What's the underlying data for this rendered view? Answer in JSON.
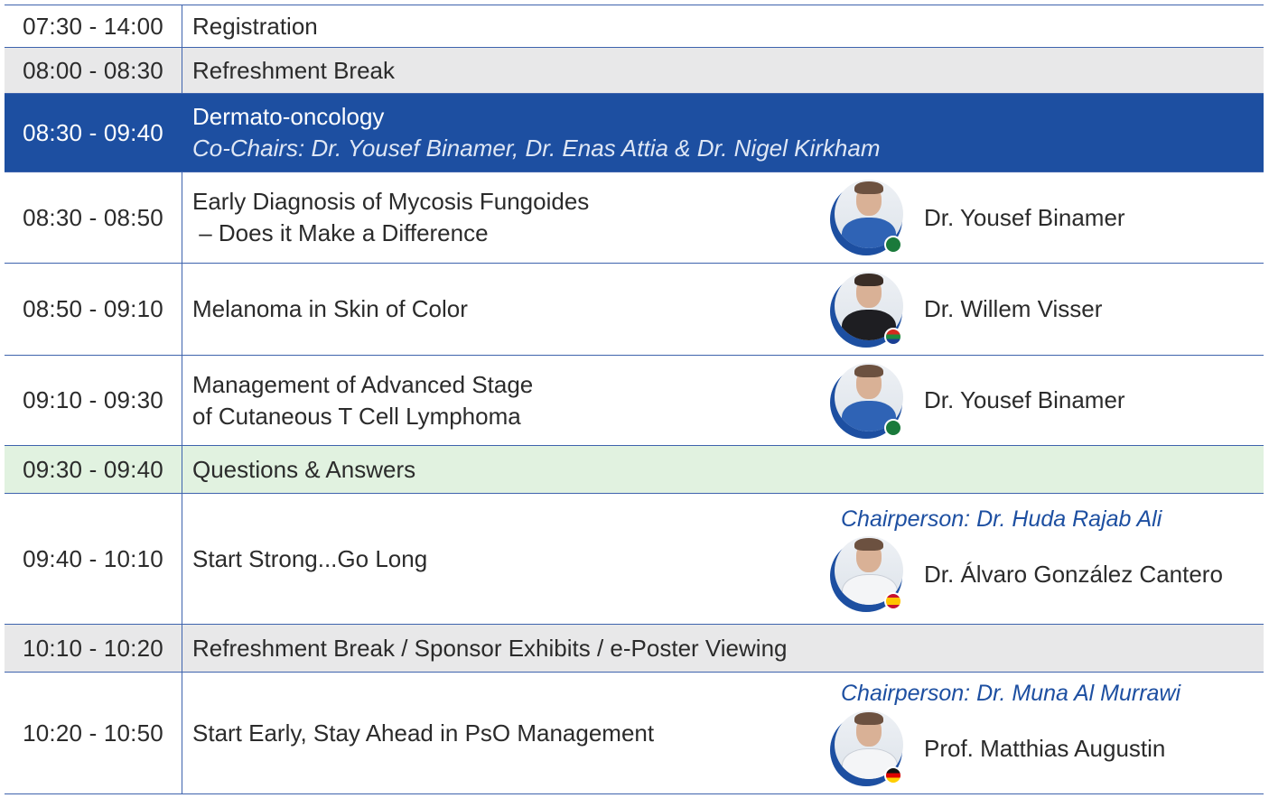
{
  "agenda": {
    "rows": [
      {
        "time": "07:30 - 14:00",
        "title": "Registration"
      },
      {
        "time": "08:00 - 08:30",
        "title": "Refreshment Break"
      },
      {
        "time": "08:30 - 09:40",
        "title": "Dermato-oncology",
        "subtitle": "Co-Chairs: Dr. Yousef Binamer, Dr. Enas Attia & Dr. Nigel Kirkham"
      },
      {
        "time": "08:30 - 08:50",
        "title_line1": "Early Diagnosis of Mycosis Fungoides",
        "title_line2": " – Does it Make a Difference",
        "speaker": "Dr. Yousef Binamer",
        "speaker_icon": "speaker-photo-icon",
        "flag_icon": "saudi-flag-icon"
      },
      {
        "time": "08:50 - 09:10",
        "title": "Melanoma in Skin of Color",
        "speaker": "Dr. Willem Visser",
        "speaker_icon": "speaker-photo-icon",
        "flag_icon": "south-africa-flag-icon"
      },
      {
        "time": "09:10 - 09:30",
        "title_line1": "Management of Advanced Stage",
        "title_line2": "of Cutaneous T Cell Lymphoma",
        "speaker": "Dr. Yousef Binamer",
        "speaker_icon": "speaker-photo-icon",
        "flag_icon": "saudi-flag-icon"
      },
      {
        "time": "09:30 - 09:40",
        "title": "Questions & Answers"
      },
      {
        "time": "09:40 - 10:10",
        "title": "Start Strong...Go Long",
        "chair": "Chairperson: Dr. Huda Rajab Ali",
        "speaker": "Dr. Álvaro González Cantero",
        "speaker_icon": "speaker-photo-icon",
        "flag_icon": "spain-flag-icon"
      },
      {
        "time": "10:10 - 10:20",
        "title": "Refreshment Break / Sponsor Exhibits / e-Poster Viewing"
      },
      {
        "time": "10:20 - 10:50",
        "title": "Start Early, Stay Ahead in PsO Management",
        "chair": "Chairperson: Dr. Muna Al Murrawi",
        "speaker": "Prof. Matthias Augustin",
        "speaker_icon": "speaker-photo-icon",
        "flag_icon": "germany-flag-icon"
      }
    ]
  },
  "colors": {
    "accent": "#1d4fa1",
    "break_bg": "#e8e8e9",
    "qa_bg": "#e1f2e0",
    "border": "#3e63ad"
  }
}
